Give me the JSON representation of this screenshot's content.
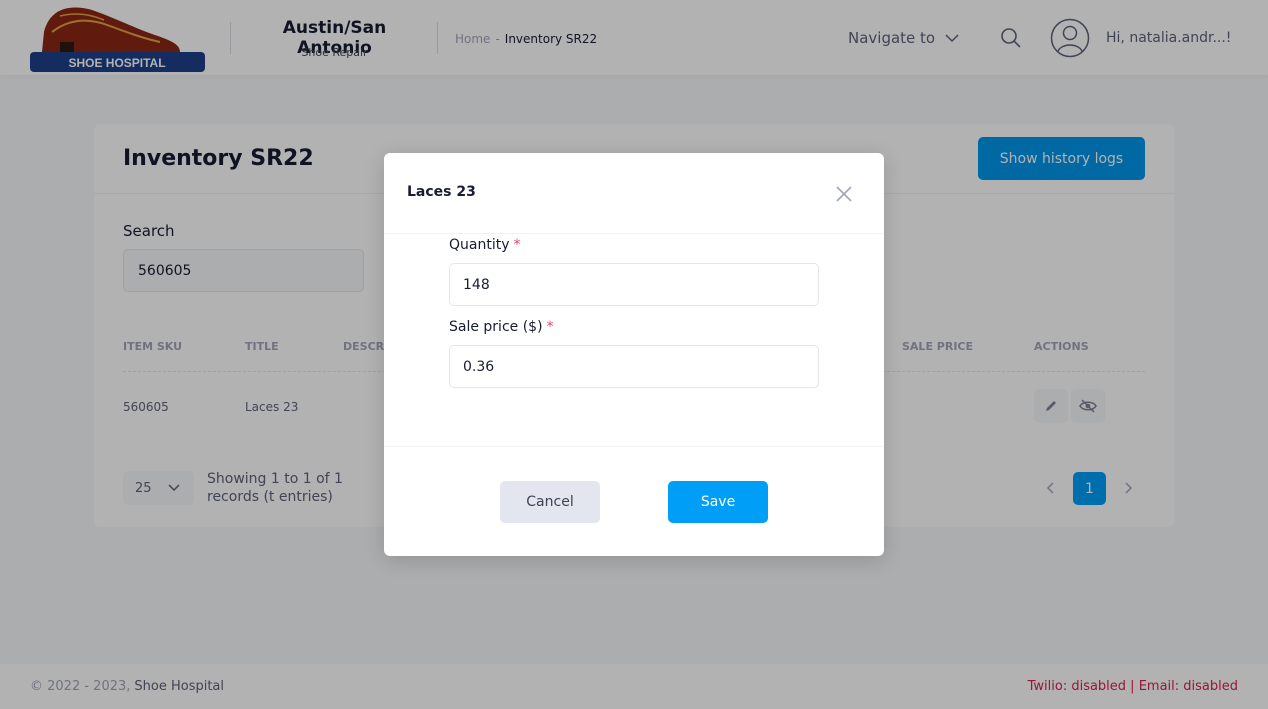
{
  "header": {
    "logo_text": "SHOE HOSPITAL",
    "org_name": "Austin/San Antonio",
    "org_subtitle": "Shoe Repair",
    "breadcrumb": {
      "home": "Home",
      "separator": "-",
      "current": "Inventory SR22"
    },
    "navigate_label": "Navigate to",
    "greeting": "Hi, natalia.andr...!"
  },
  "page": {
    "title": "Inventory SR22",
    "history_button": "Show history logs",
    "search": {
      "label": "Search",
      "value": "560605"
    }
  },
  "table": {
    "columns": [
      "ITEM SKU",
      "TITLE",
      "DESCR",
      "SALE PRICE",
      "ACTIONS"
    ],
    "rows": [
      {
        "sku": "560605",
        "title": "Laces 23"
      }
    ]
  },
  "pagination": {
    "page_size": "25",
    "showing_text": "Showing 1 to 1 of 1 records (t entries)",
    "current_page": "1"
  },
  "modal": {
    "title": "Laces 23",
    "fields": [
      {
        "label": "Quantity",
        "required_mark": "*",
        "value": "148"
      },
      {
        "label": "Sale price ($)",
        "required_mark": "*",
        "value": "0.36"
      }
    ],
    "cancel_label": "Cancel",
    "save_label": "Save"
  },
  "footer": {
    "copyright": "© 2022 - 2023,",
    "brand": "Shoe Hospital",
    "status": "Twilio: disabled | Email: disabled"
  },
  "colors": {
    "primary": "#009ef7",
    "danger": "#f1416c",
    "status_red": "#d9214e",
    "overlay": "rgba(0,0,0,0.3)"
  }
}
